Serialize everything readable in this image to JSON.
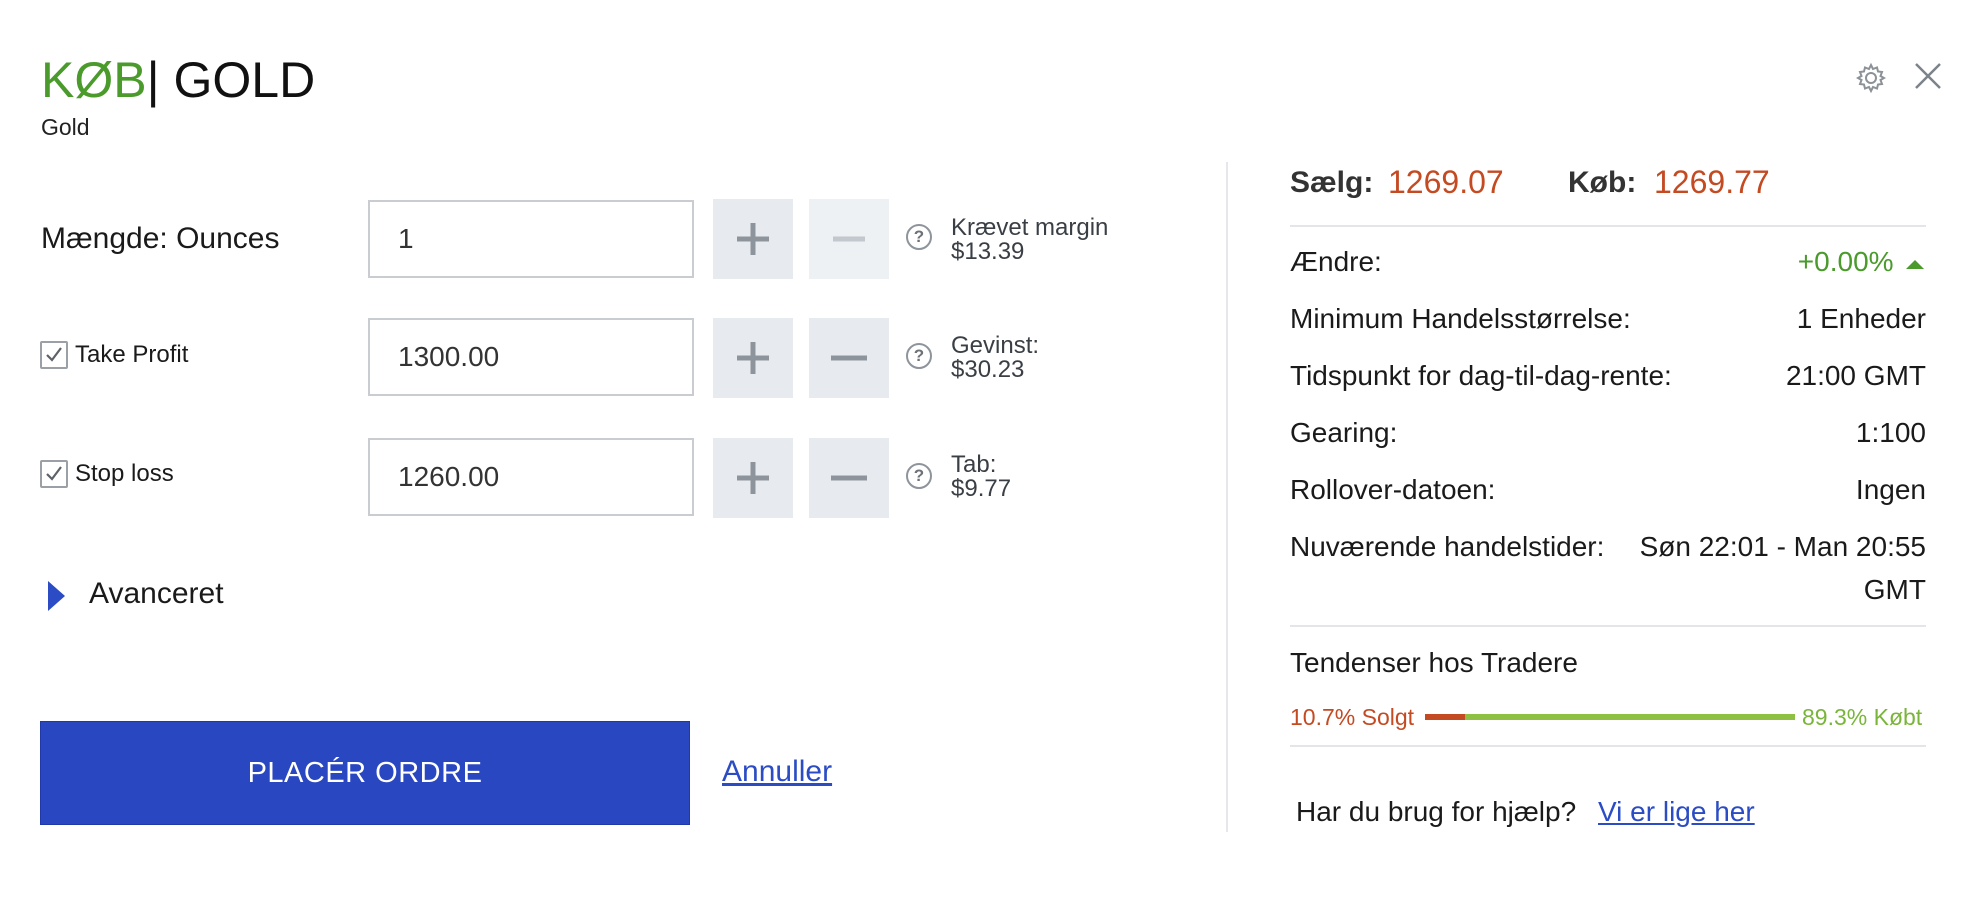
{
  "header": {
    "action": "KØB",
    "separator": "|",
    "instrument": "GOLD",
    "subtitle": "Gold"
  },
  "icons": {
    "settings": "gear-icon",
    "close": "close-icon",
    "help": "question-circle-icon",
    "plus": "plus-icon",
    "minus": "minus-icon",
    "expand": "triangle-right-icon",
    "change_up": "triangle-up-icon",
    "checkbox": "checkmark-icon"
  },
  "form": {
    "quantity": {
      "label": "Mængde: Ounces",
      "value": "1",
      "info_label": "Krævet margin",
      "info_value": "$13.39"
    },
    "take_profit": {
      "label": "Take Profit",
      "checked": true,
      "value": "1300.00",
      "info_label": "Gevinst:",
      "info_value": "$30.23"
    },
    "stop_loss": {
      "label": "Stop loss",
      "checked": true,
      "value": "1260.00",
      "info_label": "Tab:",
      "info_value": "$9.77"
    },
    "advanced_label": "Avanceret",
    "place_order_label": "PLACÉR ORDRE",
    "cancel_label": "Annuller"
  },
  "market": {
    "sell_label": "Sælg:",
    "sell_price": "1269.07",
    "buy_label": "Køb:",
    "buy_price": "1269.77",
    "rows": [
      {
        "label": "Ændre:",
        "value": "+0.00%"
      },
      {
        "label": "Minimum Handelsstørrelse:",
        "value": "1 Enheder"
      },
      {
        "label": "Tidspunkt for dag-til-dag-rente:",
        "value": "21:00 GMT"
      },
      {
        "label": "Gearing:",
        "value": "1:100"
      },
      {
        "label": "Rollover-datoen:",
        "value": "Ingen"
      },
      {
        "label": "Nuværende handelstider:",
        "value_line1": "Søn 22:01 - Man 20:55",
        "value_line2": "GMT"
      }
    ]
  },
  "sentiment": {
    "title": "Tendenser hos Tradere",
    "sold_label": "10.7% Solgt",
    "bought_label": "89.3% Købt",
    "sold_fraction": 0.107,
    "bought_fraction": 0.893,
    "sold_color": "#c44a22",
    "bought_color": "#8ec044"
  },
  "help": {
    "text": "Har du brug for hjælp?",
    "link": "Vi er lige her"
  },
  "colors": {
    "accent_blue": "#2a47c2",
    "buy_green": "#4a9a2c",
    "price_red": "#c44a22"
  }
}
